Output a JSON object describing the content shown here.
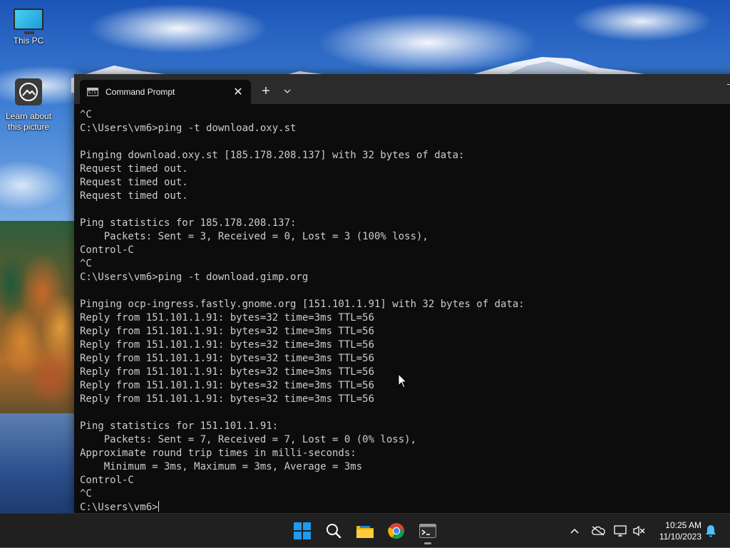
{
  "desktop": {
    "icons": [
      {
        "label": "This PC",
        "icon": "monitor-icon"
      },
      {
        "label": "Learn about this picture",
        "line1": "Learn about",
        "line2": "this picture",
        "icon": "camera-info-icon"
      }
    ]
  },
  "window": {
    "tab_title": "Command Prompt",
    "tab_close": "✕",
    "new_tab": "+",
    "dropdown": "⌄"
  },
  "console": {
    "lines": [
      "^C",
      "C:\\Users\\vm6>ping -t download.oxy.st",
      "",
      "Pinging download.oxy.st [185.178.208.137] with 32 bytes of data:",
      "Request timed out.",
      "Request timed out.",
      "Request timed out.",
      "",
      "Ping statistics for 185.178.208.137:",
      "    Packets: Sent = 3, Received = 0, Lost = 3 (100% loss),",
      "Control-C",
      "^C",
      "C:\\Users\\vm6>ping -t download.gimp.org",
      "",
      "Pinging ocp-ingress.fastly.gnome.org [151.101.1.91] with 32 bytes of data:",
      "Reply from 151.101.1.91: bytes=32 time=3ms TTL=56",
      "Reply from 151.101.1.91: bytes=32 time=3ms TTL=56",
      "Reply from 151.101.1.91: bytes=32 time=3ms TTL=56",
      "Reply from 151.101.1.91: bytes=32 time=3ms TTL=56",
      "Reply from 151.101.1.91: bytes=32 time=3ms TTL=56",
      "Reply from 151.101.1.91: bytes=32 time=3ms TTL=56",
      "Reply from 151.101.1.91: bytes=32 time=3ms TTL=56",
      "",
      "Ping statistics for 151.101.1.91:",
      "    Packets: Sent = 7, Received = 7, Lost = 0 (0% loss),",
      "Approximate round trip times in milli-seconds:",
      "    Minimum = 3ms, Maximum = 3ms, Average = 3ms",
      "Control-C",
      "^C"
    ],
    "prompt": "C:\\Users\\vm6>"
  },
  "taskbar": {
    "apps": [
      {
        "name": "start",
        "icon": "windows-logo-icon"
      },
      {
        "name": "search",
        "icon": "search-icon"
      },
      {
        "name": "file-explorer",
        "icon": "folder-icon"
      },
      {
        "name": "chrome",
        "icon": "chrome-icon"
      },
      {
        "name": "terminal",
        "icon": "terminal-icon",
        "active": true
      }
    ],
    "tray": {
      "icons": [
        "chevron-up-icon",
        "onedrive-offline-icon",
        "network-icon",
        "volume-muted-icon",
        "notification-bell-icon"
      ]
    },
    "clock": {
      "time": "10:25 AM",
      "date": "11/10/2023"
    }
  },
  "colors": {
    "console_bg": "#0c0c0c",
    "console_fg": "#cccccc",
    "tabbar_bg": "#2b2b2b",
    "taskbar_bg": "#202020"
  }
}
